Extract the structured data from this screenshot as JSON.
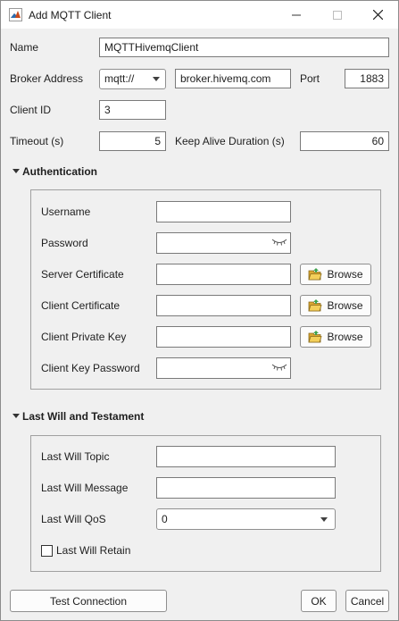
{
  "window": {
    "title": "Add MQTT Client"
  },
  "general": {
    "name_label": "Name",
    "name_value": "MQTTHivemqClient",
    "broker_label": "Broker Address",
    "broker_scheme": "mqtt://",
    "broker_host": "broker.hivemq.com",
    "port_label": "Port",
    "port_value": "1883",
    "client_id_label": "Client ID",
    "client_id_value": "3",
    "timeout_label": "Timeout (s)",
    "timeout_value": "5",
    "keepalive_label": "Keep Alive Duration (s)",
    "keepalive_value": "60"
  },
  "authentication": {
    "title": "Authentication",
    "username_label": "Username",
    "username_value": "",
    "password_label": "Password",
    "password_value": "",
    "server_cert_label": "Server Certificate",
    "client_cert_label": "Client Certificate",
    "client_key_label": "Client Private Key",
    "client_key_password_label": "Client Key Password",
    "browse_label": "Browse"
  },
  "last_will": {
    "title": "Last Will and Testament",
    "topic_label": "Last Will Topic",
    "message_label": "Last Will Message",
    "qos_label": "Last Will QoS",
    "qos_value": "0",
    "retain_label": "Last Will Retain"
  },
  "footer": {
    "test_label": "Test Connection",
    "ok_label": "OK",
    "cancel_label": "Cancel"
  }
}
